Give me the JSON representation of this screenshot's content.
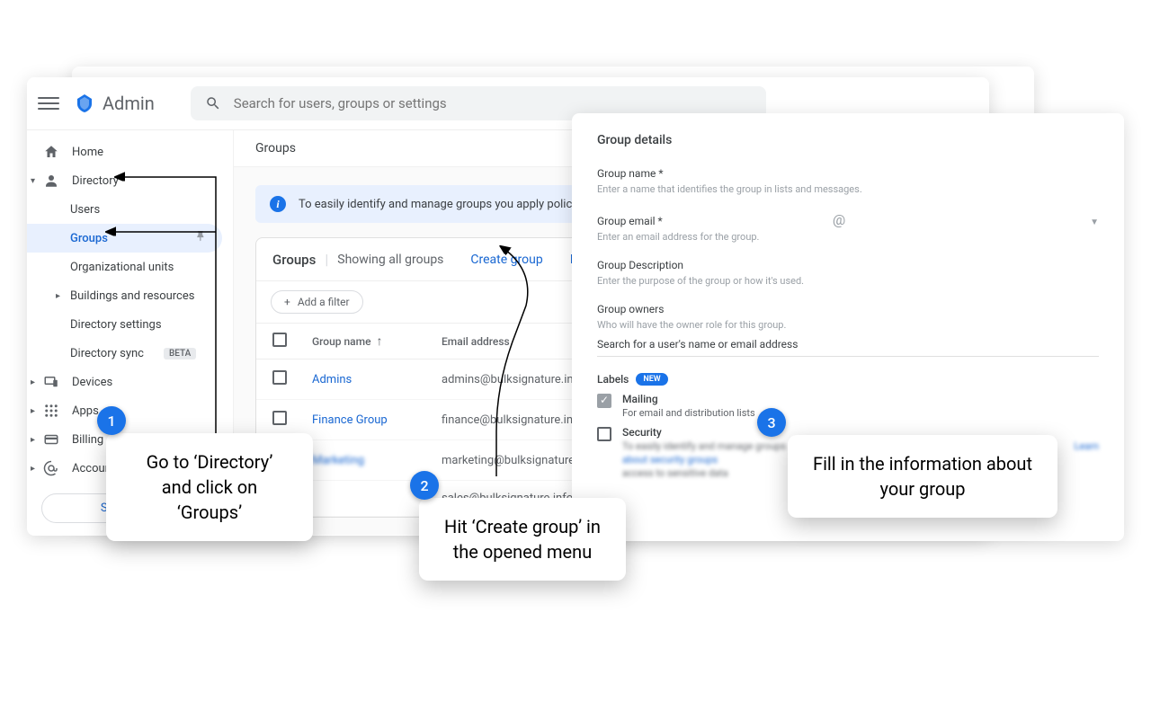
{
  "header": {
    "app_name": "Admin",
    "search_placeholder": "Search for users, groups or settings"
  },
  "sidebar": {
    "items": [
      {
        "icon": "home",
        "label": "Home"
      },
      {
        "icon": "person",
        "label": "Directory",
        "expanded": true
      },
      {
        "label": "Users",
        "sub": true
      },
      {
        "label": "Groups",
        "sub": true,
        "active": true
      },
      {
        "label": "Organizational units",
        "sub": true
      },
      {
        "label": "Buildings and resources",
        "sub": true,
        "chev": true
      },
      {
        "label": "Directory settings",
        "sub": true
      },
      {
        "label": "Directory sync",
        "sub": true,
        "beta": "BETA"
      },
      {
        "icon": "devices",
        "label": "Devices",
        "chev": true
      },
      {
        "icon": "apps",
        "label": "Apps",
        "chev": true
      },
      {
        "icon": "billing",
        "label": "Billing",
        "chev": true
      },
      {
        "icon": "account",
        "label": "Account",
        "chev": true
      }
    ],
    "show_more": "Show more"
  },
  "content": {
    "breadcrumb": "Groups",
    "banner": "To easily identify and manage groups you apply policies to",
    "card": {
      "title": "Groups",
      "subtitle": "Showing all groups",
      "create": "Create group",
      "inspect": "Inspe"
    },
    "filter": "Add a filter",
    "columns": {
      "name": "Group name",
      "email": "Email address"
    },
    "rows": [
      {
        "name": "Admins",
        "email": "admins@bulksignature.info"
      },
      {
        "name": "Finance Group",
        "email": "finance@bulksignature.info"
      },
      {
        "name": "Marketing",
        "email": "marketing@bulksignature.info",
        "blur": true
      },
      {
        "name": "",
        "email": "sales@bulksignature.info"
      }
    ]
  },
  "details": {
    "title": "Group details",
    "name_label": "Group name *",
    "name_hint": "Enter a name that identifies the group in lists and messages.",
    "email_label": "Group email *",
    "email_hint": "Enter an email address for the group.",
    "at": "@",
    "desc_label": "Group Description",
    "desc_hint": "Enter the purpose of the group or how it's used.",
    "owners_label": "Group owners",
    "owners_hint": "Who will have the owner role for this group.",
    "owners_search": "Search for a user's name or email address",
    "labels_label": "Labels",
    "new_badge": "NEW",
    "mailing": {
      "title": "Mailing",
      "sub": "For email and distribution lists"
    },
    "security": {
      "title": "Security",
      "sub1": "To easily identify and manage groups",
      "sub2": "about security groups",
      "sub3": "access to sensitive data",
      "learn": "Learn"
    }
  },
  "callouts": {
    "c1": {
      "num": "1",
      "text": "Go to ‘Directory’ and click on ‘Groups’"
    },
    "c2": {
      "num": "2",
      "text": "Hit ‘Create group’ in the opened menu"
    },
    "c3": {
      "num": "3",
      "text": "Fill in the information about your group"
    }
  }
}
